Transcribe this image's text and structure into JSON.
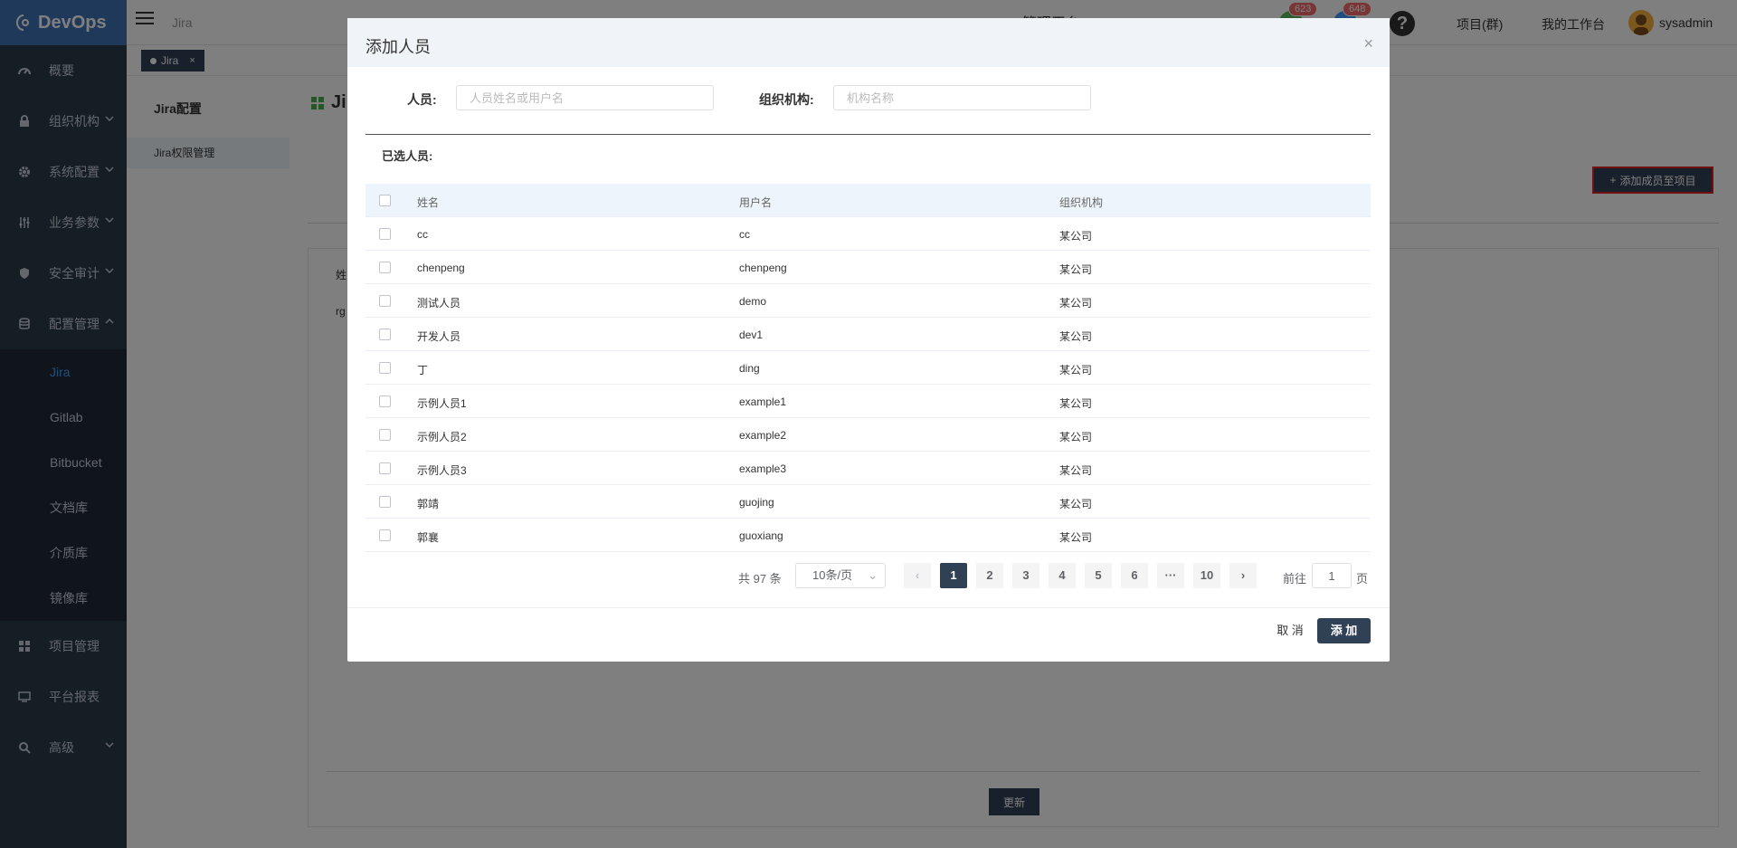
{
  "app": {
    "logo_text": "DevOps"
  },
  "sidebar": {
    "items": [
      {
        "label": "概要",
        "icon": "dashboard-icon"
      },
      {
        "label": "组织机构",
        "icon": "lock-icon"
      },
      {
        "label": "系统配置",
        "icon": "gear-icon"
      },
      {
        "label": "业务参数",
        "icon": "sliders-icon"
      },
      {
        "label": "安全审计",
        "icon": "shield-icon"
      },
      {
        "label": "配置管理",
        "icon": "database-icon"
      }
    ],
    "sub_items": [
      "Jira",
      "Gitlab",
      "Bitbucket",
      "文档库",
      "介质库",
      "镜像库"
    ],
    "bottom_items": [
      {
        "label": "项目管理",
        "icon": "grid-icon"
      },
      {
        "label": "平台报表",
        "icon": "monitor-icon"
      },
      {
        "label": "高级",
        "icon": "advanced-icon"
      }
    ]
  },
  "header": {
    "breadcrumb": "Jira",
    "title": "管理平台",
    "badge1": "623",
    "badge2": "648",
    "nav_projects": "项目(群)",
    "nav_workspace": "我的工作台",
    "username": "sysadmin"
  },
  "tabs": {
    "jira": "Jira",
    "close": "×"
  },
  "subpanel": {
    "title": "Jira配置",
    "item": "Jira权限管理"
  },
  "main": {
    "title": "Jira",
    "add_member_button": "添加成员至项目",
    "card_text1": "姓",
    "card_text2": "rg",
    "update_button": "更新"
  },
  "dialog": {
    "title": "添加人员",
    "close": "×",
    "person_label": "人员:",
    "person_placeholder": "人员姓名或用户名",
    "org_label": "组织机构:",
    "org_placeholder": "机构名称",
    "selected_label": "已选人员:",
    "columns": [
      "姓名",
      "用户名",
      "组织机构"
    ],
    "rows": [
      {
        "name": "cc",
        "username": "cc",
        "org": "某公司"
      },
      {
        "name": "chenpeng",
        "username": "chenpeng",
        "org": "某公司"
      },
      {
        "name": "测试人员",
        "username": "demo",
        "org": "某公司"
      },
      {
        "name": "开发人员",
        "username": "dev1",
        "org": "某公司"
      },
      {
        "name": "丁",
        "username": "ding",
        "org": "某公司"
      },
      {
        "name": "示例人员1",
        "username": "example1",
        "org": "某公司"
      },
      {
        "name": "示例人员2",
        "username": "example2",
        "org": "某公司"
      },
      {
        "name": "示例人员3",
        "username": "example3",
        "org": "某公司"
      },
      {
        "name": "郭靖",
        "username": "guojing",
        "org": "某公司"
      },
      {
        "name": "郭襄",
        "username": "guoxiang",
        "org": "某公司"
      }
    ],
    "pager": {
      "total": "共 97 条",
      "page_size": "10条/页",
      "pages": [
        "1",
        "2",
        "3",
        "4",
        "5",
        "6",
        "···",
        "10"
      ],
      "current": "1",
      "goto_label": "前往",
      "goto_value": "1",
      "page_label": "页"
    },
    "cancel_button": "取 消",
    "add_button": "添 加"
  }
}
